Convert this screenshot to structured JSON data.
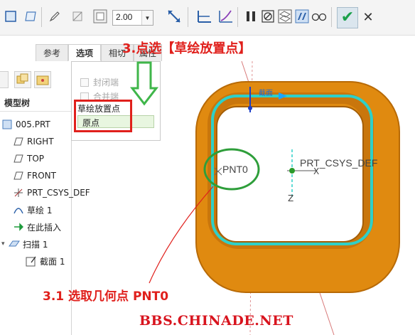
{
  "toolbar": {
    "thickness_value": "2.00",
    "icons": [
      "solid-icon",
      "surface-icon",
      "pencil-icon",
      "diagonal-icon",
      "frame-icon",
      "thickness-dropdown-icon",
      "flip-icon",
      "constant-section-icon",
      "variable-section-icon",
      "pause-icon",
      "no-preview-icon",
      "preview-mesh-icon",
      "preview-icon",
      "glasses-icon",
      "confirm-icon",
      "cancel-icon"
    ],
    "confirm_label": "✔",
    "cancel_label": "✕"
  },
  "tabs": [
    {
      "label": "参考",
      "active": false
    },
    {
      "label": "选项",
      "active": true
    },
    {
      "label": "相切",
      "active": false
    },
    {
      "label": "属性",
      "active": false
    }
  ],
  "options_panel": {
    "closed_ends": "封闭端",
    "merge_ends": "合并端",
    "sketch_placement_label": "草绘放置点",
    "sketch_placement_value": "原点"
  },
  "model_tree": {
    "title": "模型树",
    "items": [
      {
        "label": "005.PRT",
        "icon": "part-icon"
      },
      {
        "label": "RIGHT",
        "icon": "datum-plane-icon"
      },
      {
        "label": "TOP",
        "icon": "datum-plane-icon"
      },
      {
        "label": "FRONT",
        "icon": "datum-plane-icon"
      },
      {
        "label": "PRT_CSYS_DEF",
        "icon": "coordinate-system-icon"
      },
      {
        "label": "草绘 1",
        "icon": "sketch-icon"
      },
      {
        "label": "在此插入",
        "icon": "insert-here-icon"
      },
      {
        "label": "扫描 1",
        "icon": "sweep-icon"
      },
      {
        "label": "截面 1",
        "icon": "section-icon"
      }
    ]
  },
  "graphics": {
    "point_label": "PNT0",
    "csys_label": "PRT_CSYS_DEF",
    "axis_x": "X",
    "axis_z": "Z",
    "section_label": "截面",
    "colors": {
      "solid": "#e08a10",
      "trajectory": "#2ed0c8",
      "annotation": "#e0201c",
      "circle": "#2e9e3a"
    }
  },
  "annotations": {
    "title": "3.点选【草绘放置点】",
    "step": "3.1 选取几何点 PNT0",
    "watermark": "BBS.CHINADE.NET"
  }
}
